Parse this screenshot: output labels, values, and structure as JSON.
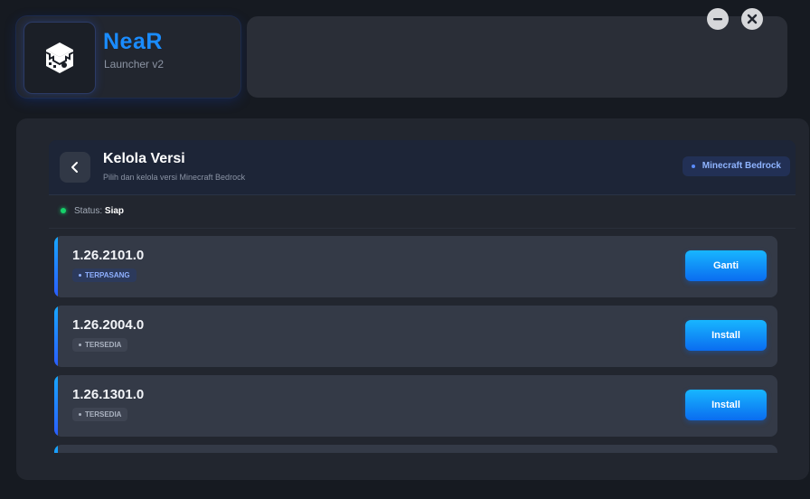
{
  "app": {
    "name": "NeaR",
    "subtitle": "Launcher v2",
    "logo_icon": "cube-logo-icon"
  },
  "window_controls": {
    "minimize_icon": "minimize-icon",
    "close_icon": "close-icon"
  },
  "panel": {
    "title": "Kelola Versi",
    "subtitle": "Pilih dan kelola versi Minecraft Bedrock",
    "back_icon": "chevron-left-icon",
    "platform_badge": "Minecraft Bedrock"
  },
  "status": {
    "label": "Status:",
    "value": "Siap",
    "color": "#16d16a"
  },
  "versions": [
    {
      "name": "1.26.2101.0",
      "badge": "TERPASANG",
      "action": "Ganti"
    },
    {
      "name": "1.26.2004.0",
      "badge": "TERSEDIA",
      "action": "Install"
    },
    {
      "name": "1.26.1301.0",
      "badge": "TERSEDIA",
      "action": "Install"
    }
  ],
  "colors": {
    "accent": "#1a8cff",
    "button_gradient_top": "#18b6ff",
    "button_gradient_bottom": "#0a6cf0",
    "background": "#161a21",
    "card": "#343a47"
  }
}
